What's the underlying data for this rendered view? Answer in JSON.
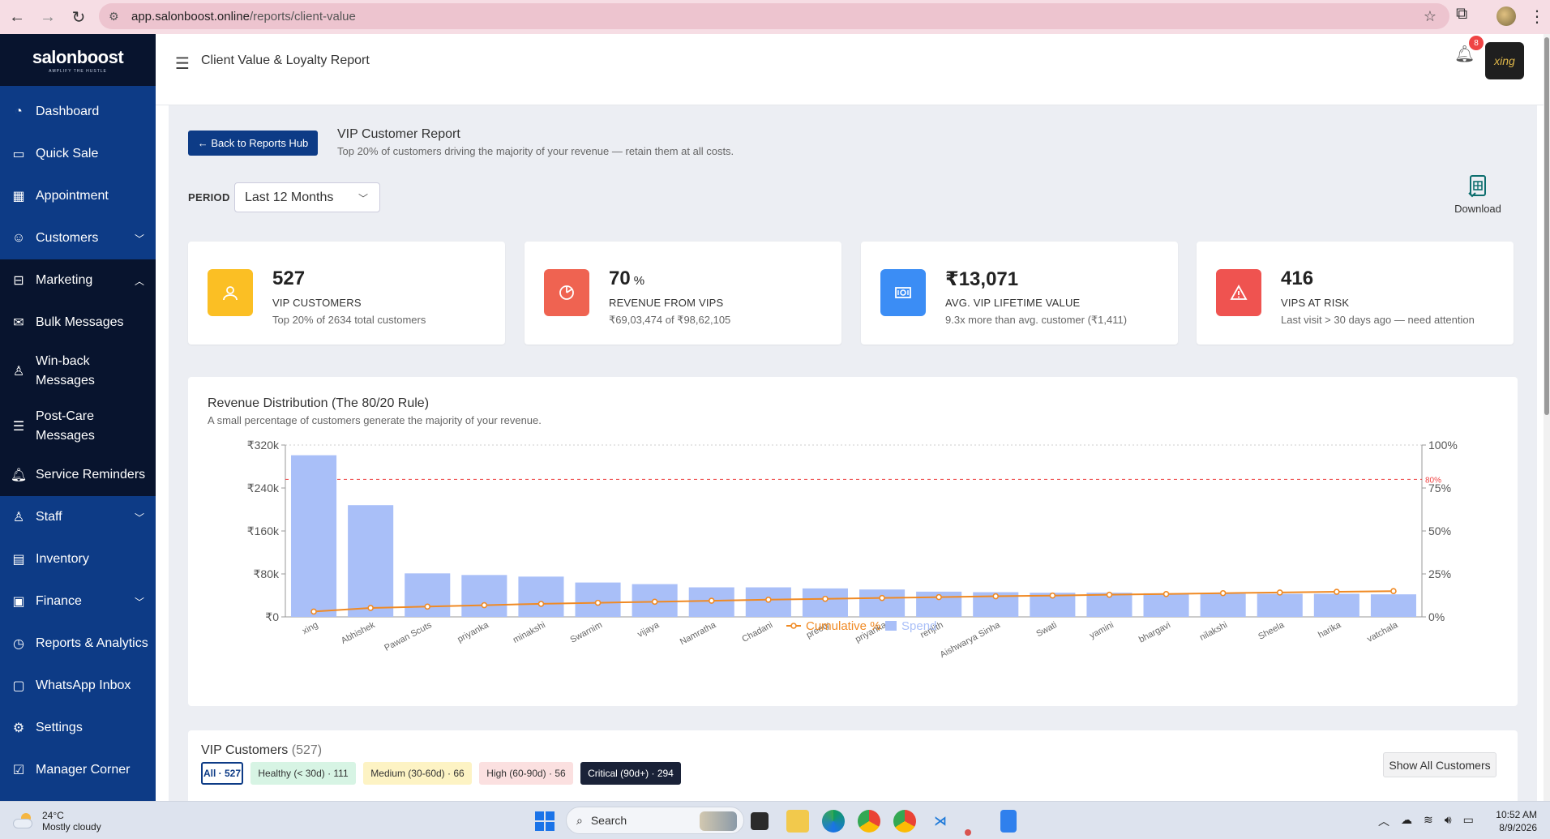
{
  "browser": {
    "url_host": "app.salonboost.online",
    "url_path": "/reports/client-value"
  },
  "brand": {
    "name": "salonboost",
    "tagline": "AMPLIFY THE HUSTLE"
  },
  "sidebar": {
    "items": [
      {
        "label": "Dashboard",
        "icon": "dashboard-icon"
      },
      {
        "label": "Quick Sale",
        "icon": "quick-sale-icon"
      },
      {
        "label": "Appointment",
        "icon": "calendar-icon"
      },
      {
        "label": "Customers",
        "icon": "users-icon",
        "chevron": "down"
      },
      {
        "label": "Marketing",
        "icon": "megaphone-icon",
        "chevron": "up"
      },
      {
        "label": "Bulk Messages",
        "icon": "envelope-icon"
      },
      {
        "label": "Win-back Messages",
        "icon": "user-return-icon"
      },
      {
        "label": "Post-Care Messages",
        "icon": "clipboard-icon"
      },
      {
        "label": "Service Reminders",
        "icon": "bell-icon"
      },
      {
        "label": "Staff",
        "icon": "staff-icon",
        "chevron": "down"
      },
      {
        "label": "Inventory",
        "icon": "boxes-icon"
      },
      {
        "label": "Finance",
        "icon": "finance-icon",
        "chevron": "down"
      },
      {
        "label": "Reports & Analytics",
        "icon": "analytics-icon"
      },
      {
        "label": "WhatsApp Inbox",
        "icon": "chat-icon"
      },
      {
        "label": "Settings",
        "icon": "gear-icon"
      },
      {
        "label": "Manager Corner",
        "icon": "checklist-icon"
      }
    ]
  },
  "header": {
    "title": "Client Value & Loyalty Report",
    "notification_count": "8",
    "avatar_text": "xing"
  },
  "report": {
    "back_label": "← Back to Reports Hub",
    "title": "VIP Customer Report",
    "subtitle": "Top 20% of customers driving the majority of your revenue — retain them at all costs.",
    "period_label": "PERIOD",
    "period_value": "Last 12 Months",
    "download_label": "Download"
  },
  "cards": [
    {
      "value": "527",
      "unit": "",
      "label": "VIP CUSTOMERS",
      "sub": "Top 20% of 2634 total customers",
      "color": "#fbbf24",
      "icon": "users-icon"
    },
    {
      "value": "70",
      "unit": "%",
      "label": "REVENUE FROM VIPS",
      "sub": "₹69,03,474 of ₹98,62,105",
      "color": "#ef6351",
      "icon": "pie-chart-icon"
    },
    {
      "value": "₹13,071",
      "unit": "",
      "label": "AVG. VIP LIFETIME VALUE",
      "sub": "9.3x more than avg. customer (₹1,411)",
      "color": "#3b8df5",
      "icon": "money-icon"
    },
    {
      "value": "416",
      "unit": "",
      "label": "VIPS AT RISK",
      "sub": "Last visit > 30 days ago — need attention",
      "color": "#ef5350",
      "icon": "warning-icon"
    }
  ],
  "chart": {
    "title": "Revenue Distribution (The 80/20 Rule)",
    "subtitle": "A small percentage of customers generate the majority of your revenue."
  },
  "chart_data": {
    "type": "bar",
    "categories": [
      "xing",
      "Abhishek",
      "Pawan Scuts",
      "priyanka",
      "minakshi",
      "Swarnim",
      "vijaya",
      "Namratha",
      "Chadani",
      "preety",
      "priyanka",
      "renjith",
      "Aishwarya Sinha",
      "Swati",
      "yamini",
      "bhargavi",
      "nilakshi",
      "Sheela",
      "harika",
      "vatchala"
    ],
    "series": [
      {
        "name": "Spend",
        "type": "bar",
        "axis": "left",
        "color": "#a9bff8",
        "values": [
          301000,
          208000,
          81000,
          78000,
          75000,
          64000,
          61000,
          55000,
          55000,
          53000,
          51000,
          47000,
          46000,
          45000,
          45000,
          44000,
          43000,
          43000,
          43000,
          42000
        ]
      },
      {
        "name": "Cumulative %",
        "type": "line",
        "axis": "right",
        "color": "#f08a24",
        "values": [
          3.1,
          5.2,
          6.0,
          6.8,
          7.6,
          8.2,
          8.8,
          9.4,
          10.0,
          10.5,
          11.0,
          11.5,
          12.0,
          12.4,
          12.9,
          13.3,
          13.8,
          14.2,
          14.6,
          15.0
        ]
      }
    ],
    "y_left": {
      "min": 0,
      "max": 320000,
      "ticks": [
        0,
        80000,
        160000,
        240000,
        320000
      ],
      "tick_labels": [
        "₹0",
        "₹80k",
        "₹160k",
        "₹240k",
        "₹320k"
      ]
    },
    "y_right": {
      "min": 0,
      "max": 100,
      "ticks": [
        0,
        25,
        50,
        75,
        100
      ],
      "tick_labels": [
        "0%",
        "25%",
        "50%",
        "75%",
        "100%"
      ]
    },
    "reference_line": {
      "value": 80,
      "axis": "right",
      "label": "80%",
      "color": "#ef4444"
    },
    "legend": [
      "Cumulative %",
      "Spend"
    ],
    "legend_position": "bottom-center",
    "grid": false
  },
  "vip_table": {
    "title": "VIP Customers",
    "count": "(527)",
    "filters": [
      {
        "label": "All · 527",
        "bg": "#ffffff",
        "fg": "#0d3b86",
        "border": "#0d3b86",
        "width": 52
      },
      {
        "label": "Healthy (< 30d) · 111",
        "bg": "#d7f4e4",
        "fg": "#333333",
        "border": "#d7f4e4",
        "width": 130
      },
      {
        "label": "Medium (30-60d) · 66",
        "bg": "#fdf3c4",
        "fg": "#333333",
        "border": "#fdf3c4",
        "width": 134
      },
      {
        "label": "High (60-90d) · 56",
        "bg": "#fbe0e0",
        "fg": "#333333",
        "border": "#fbe0e0",
        "width": 116
      },
      {
        "label": "Critical (90d+) · 294",
        "bg": "#1a2238",
        "fg": "#ffffff",
        "border": "#1a2238",
        "width": 124
      }
    ],
    "show_all_label": "Show All Customers"
  },
  "taskbar": {
    "temperature": "24°C",
    "weather": "Mostly cloudy",
    "search_placeholder": "Search",
    "time": "10:52 AM",
    "date": "8/9/2026"
  }
}
